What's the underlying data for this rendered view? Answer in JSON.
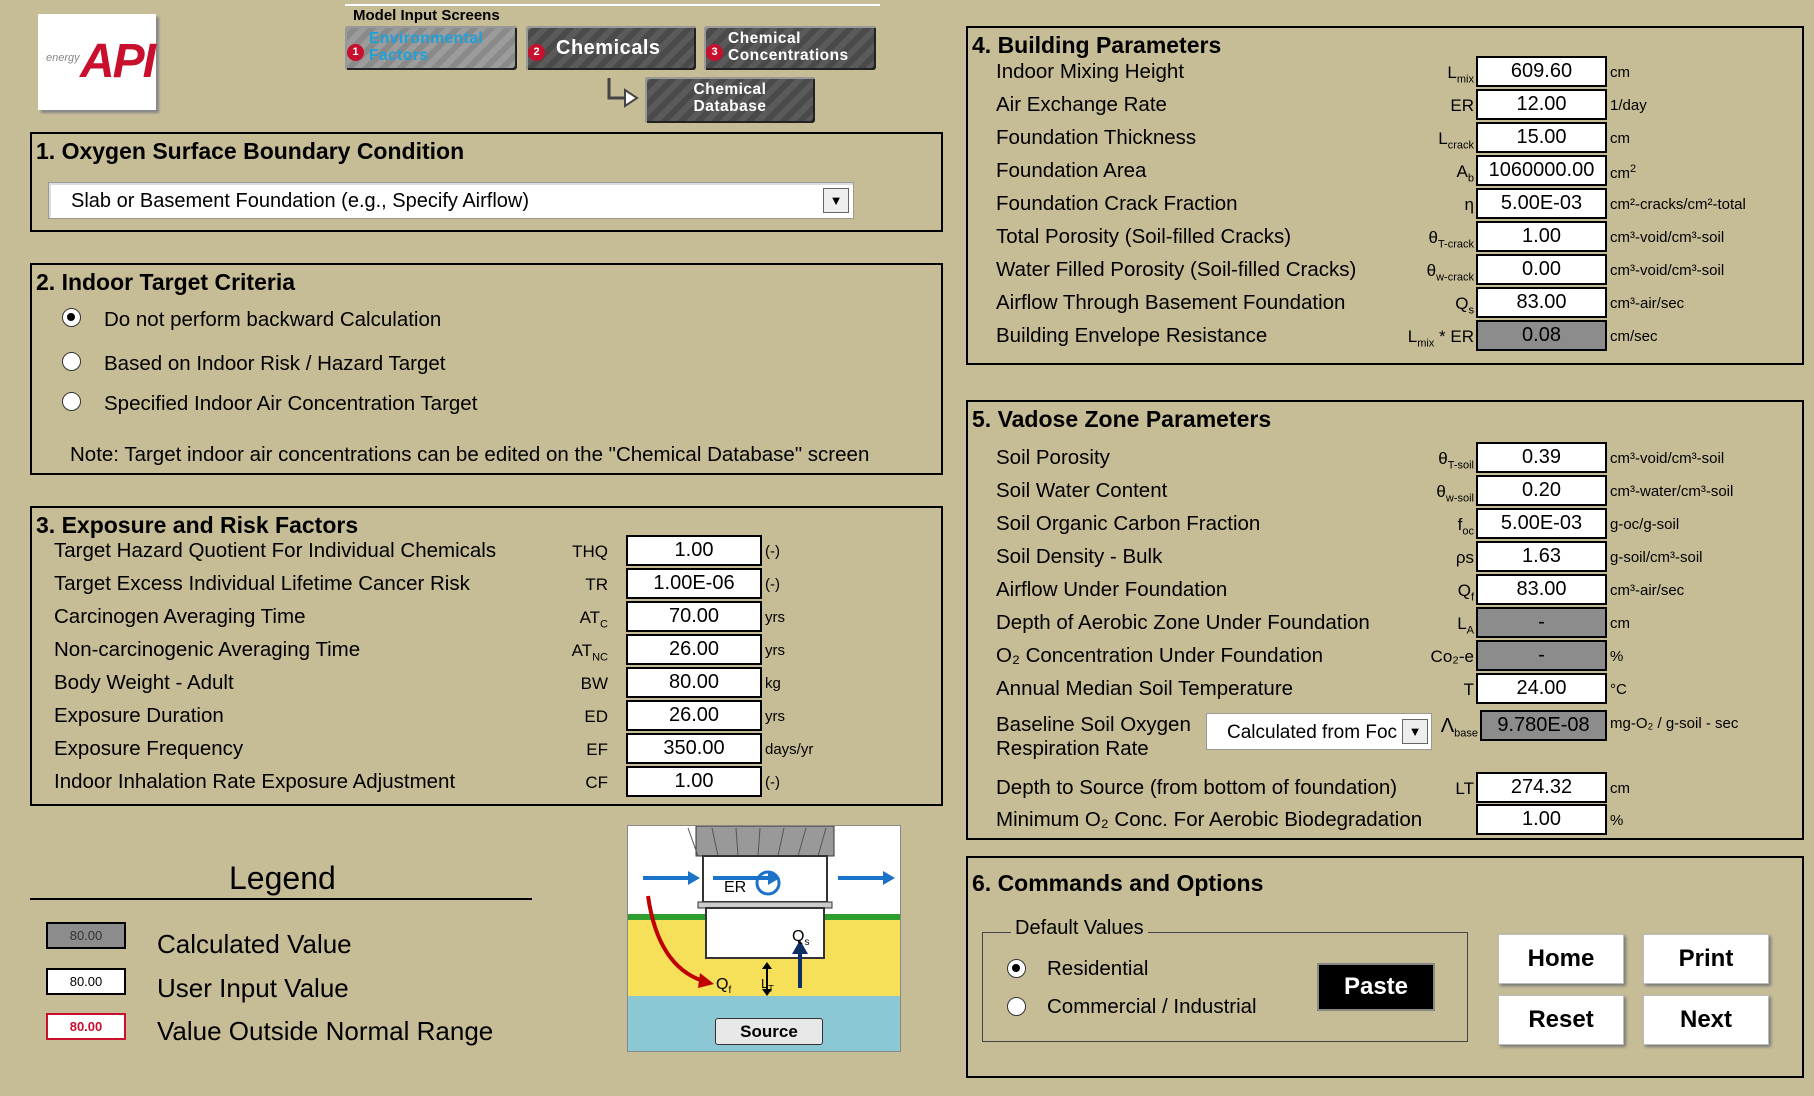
{
  "logo": {
    "small": "energy",
    "brand": "API"
  },
  "nav": {
    "title": "Model Input Screens",
    "env": {
      "num": "1",
      "line1": "Environmental",
      "line2": "Factors"
    },
    "chem": {
      "num": "2",
      "label": "Chemicals"
    },
    "conc": {
      "num": "3",
      "line1": "Chemical",
      "line2": "Concentrations"
    },
    "db": {
      "line1": "Chemical",
      "line2": "Database"
    }
  },
  "s1": {
    "title": "1. Oxygen Surface Boundary Condition",
    "selected": "Slab or Basement Foundation (e.g., Specify Airflow)"
  },
  "s2": {
    "title": "2. Indoor Target Criteria",
    "options": [
      "Do not perform backward Calculation",
      "Based on Indoor Risk / Hazard Target",
      "Specified Indoor Air Concentration Target"
    ],
    "selected_index": 0,
    "note": "Note: Target indoor air concentrations can be edited on the \"Chemical Database\" screen"
  },
  "s3": {
    "title": "3. Exposure and Risk Factors",
    "rows": [
      {
        "label": "Target Hazard Quotient For Individual Chemicals",
        "sym": "THQ",
        "value": "1.00",
        "unit": "(-)"
      },
      {
        "label": "Target Excess Individual Lifetime Cancer Risk",
        "sym": "TR",
        "value": "1.00E-06",
        "unit": "(-)"
      },
      {
        "label": "Carcinogen Averaging Time",
        "sym": "AT",
        "sub": "C",
        "value": "70.00",
        "unit": "yrs"
      },
      {
        "label": "Non-carcinogenic Averaging Time",
        "sym": "AT",
        "sub": "NC",
        "value": "26.00",
        "unit": "yrs"
      },
      {
        "label": "Body Weight - Adult",
        "sym": "BW",
        "value": "80.00",
        "unit": "kg"
      },
      {
        "label": "Exposure Duration",
        "sym": "ED",
        "value": "26.00",
        "unit": "yrs"
      },
      {
        "label": "Exposure Frequency",
        "sym": "EF",
        "value": "350.00",
        "unit": "days/yr"
      },
      {
        "label": "Indoor Inhalation Rate Exposure Adjustment",
        "sym": "CF",
        "value": "1.00",
        "unit": "(-)"
      }
    ]
  },
  "legend": {
    "title": "Legend",
    "items": [
      {
        "sample": "80.00",
        "label": "Calculated Value"
      },
      {
        "sample": "80.00",
        "label": "User Input Value"
      },
      {
        "sample": "80.00",
        "label": "Value Outside Normal  Range"
      }
    ]
  },
  "diagram": {
    "er": "ER",
    "qs": "Q",
    "qs_sub": "s",
    "qf": "Q",
    "qf_sub": "f",
    "lt": "L",
    "lt_sub": "T",
    "source": "Source"
  },
  "s4": {
    "title": "4. Building Parameters",
    "rows": [
      {
        "label": "Indoor Mixing Height",
        "sym": "L",
        "sub": "mix",
        "value": "609.60",
        "unit": "cm"
      },
      {
        "label": "Air Exchange Rate",
        "sym": "ER",
        "value": "12.00",
        "unit": "1/day"
      },
      {
        "label": "Foundation Thickness",
        "sym": "L",
        "sub": "crack",
        "value": "15.00",
        "unit": "cm"
      },
      {
        "label": "Foundation Area",
        "sym": "A",
        "sub": "b",
        "value": "1060000.00",
        "unit": "cm",
        "unit_sup": "2"
      },
      {
        "label": "Foundation Crack Fraction",
        "sym": "η",
        "value": "5.00E-03",
        "unit": "cm²-cracks/cm²-total"
      },
      {
        "label": "Total Porosity (Soil-filled Cracks)",
        "sym": "θ",
        "sub": "T-crack",
        "value": "1.00",
        "unit": "cm³-void/cm³-soil"
      },
      {
        "label": "Water Filled Porosity (Soil-filled Cracks)",
        "sym": "θ",
        "sub": "w-crack",
        "value": "0.00",
        "unit": "cm³-void/cm³-soil"
      },
      {
        "label": "Airflow Through Basement Foundation",
        "sym": "Q",
        "sub": "s",
        "value": "83.00",
        "unit": "cm³-air/sec"
      },
      {
        "label": "Building Envelope Resistance",
        "sym": "L",
        "sub": "mix",
        "sym2": " * ER",
        "value": "0.08",
        "unit": "cm/sec",
        "calc": true
      }
    ]
  },
  "s5": {
    "title": "5. Vadose Zone Parameters",
    "rows": [
      {
        "label": "Soil Porosity",
        "sym": "θ",
        "sub": "T-soil",
        "value": "0.39",
        "unit": "cm³-void/cm³-soil"
      },
      {
        "label": "Soil Water Content",
        "sym": "θ",
        "sub": "w-soil",
        "value": "0.20",
        "unit": "cm³-water/cm³-soil"
      },
      {
        "label": "Soil Organic Carbon Fraction",
        "sym": "f",
        "sub": "oc",
        "value": "5.00E-03",
        "unit": "g-oc/g-soil"
      },
      {
        "label": "Soil Density - Bulk",
        "sym": "ρs",
        "value": "1.63",
        "unit": "g-soil/cm³-soil"
      },
      {
        "label": "Airflow Under Foundation",
        "sym": "Q",
        "sub": "f",
        "value": "83.00",
        "unit": "cm³-air/sec"
      },
      {
        "label": "Depth of Aerobic Zone Under Foundation",
        "sym": "L",
        "sub": "A",
        "value": "-",
        "unit": "cm",
        "calc": true
      },
      {
        "label": "O₂ Concentration Under Foundation",
        "sym": "Co₂-e",
        "value": "-",
        "unit": "%",
        "calc": true
      },
      {
        "label": "Annual Median Soil Temperature",
        "sym": "T",
        "value": "24.00",
        "unit": "°C"
      }
    ],
    "resp": {
      "label1": "Baseline Soil Oxygen",
      "label2": "Respiration Rate",
      "select": "Calculated from Foc",
      "sym": "Λ",
      "sub": "base",
      "value": "9.780E-08",
      "unit": "mg-O₂ / g-soil - sec"
    },
    "rows2": [
      {
        "label": "Depth to Source (from bottom of foundation)",
        "sym": "LT",
        "value": "274.32",
        "unit": "cm"
      },
      {
        "label": "Minimum O₂ Conc. For Aerobic Biodegradation",
        "sym": "",
        "value": "1.00",
        "unit": "%"
      }
    ]
  },
  "s6": {
    "title": "6. Commands and Options",
    "group": "Default Values",
    "options": [
      "Residential",
      "Commercial / Industrial"
    ],
    "selected_index": 0,
    "paste": "Paste",
    "home": "Home",
    "print": "Print",
    "reset": "Reset",
    "next": "Next"
  }
}
